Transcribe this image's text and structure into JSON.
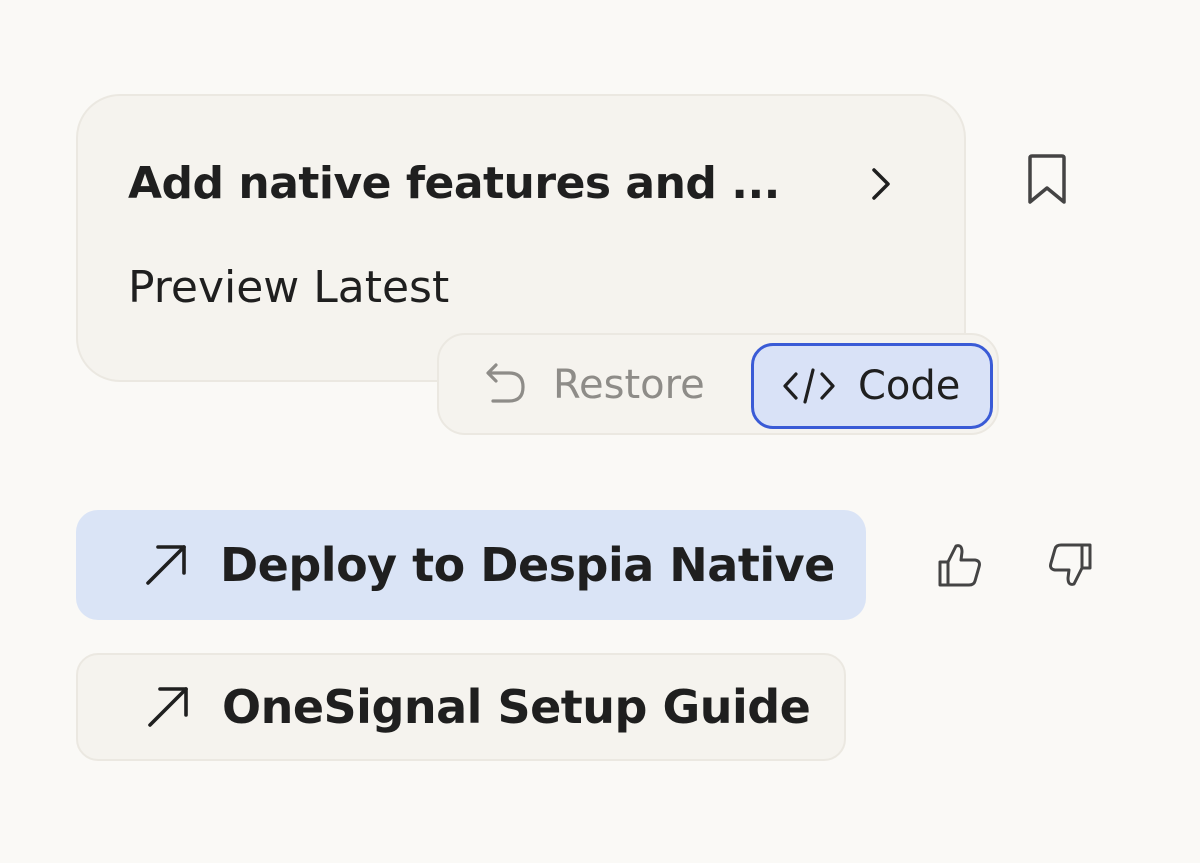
{
  "version_card": {
    "title": "Add native features and ...",
    "subtitle": "Preview Latest",
    "chevron_icon": "chevron-right-icon",
    "bookmark_icon": "bookmark-icon"
  },
  "actions": {
    "restore_label": "Restore",
    "restore_icon": "undo-icon",
    "code_label": "Code",
    "code_icon": "code-icon",
    "code_accent": "#3a5bd6"
  },
  "links": [
    {
      "label": "Deploy to Despia Native",
      "icon": "arrow-up-right-icon",
      "background": "#dae4f6"
    },
    {
      "label": "OneSignal Setup Guide",
      "icon": "arrow-up-right-icon",
      "background": "#f5f3ee"
    }
  ],
  "feedback": {
    "like_icon": "thumbs-up-icon",
    "dislike_icon": "thumbs-down-icon"
  }
}
